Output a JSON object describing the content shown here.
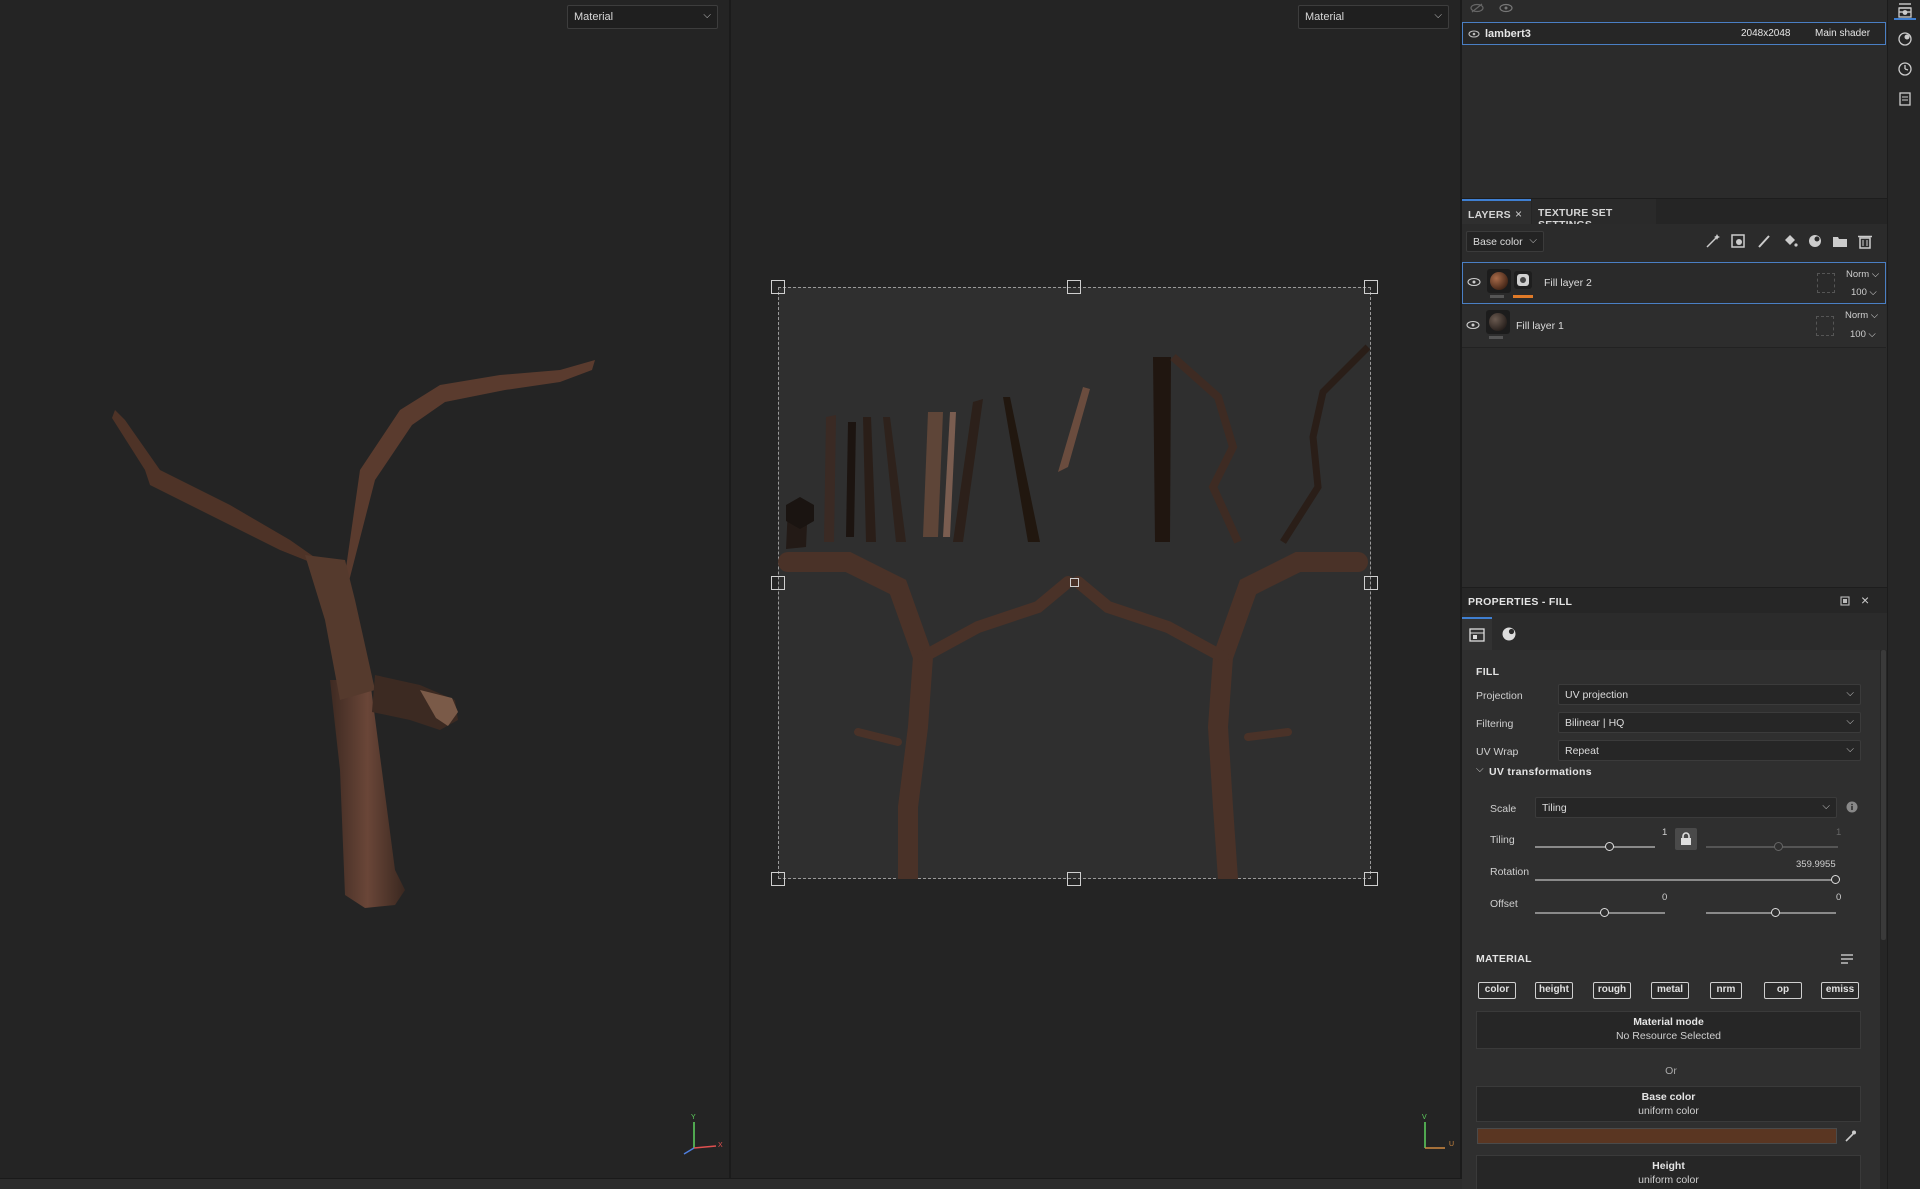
{
  "viewports": {
    "left_mode": "Material",
    "right_mode": "Material"
  },
  "texture_set": {
    "name": "lambert3",
    "resolution": "2048x2048",
    "shader": "Main shader"
  },
  "layers_panel": {
    "tab_layers": "LAYERS",
    "tab_texture_set": "TEXTURE SET SETTINGS",
    "channel_select": "Base color",
    "layers": [
      {
        "name": "Fill layer 2",
        "blend": "Norm",
        "opacity": "100",
        "selected": true
      },
      {
        "name": "Fill layer 1",
        "blend": "Norm",
        "opacity": "100",
        "selected": false
      }
    ]
  },
  "properties": {
    "title": "PROPERTIES - FILL",
    "fill_section": "FILL",
    "projection_label": "Projection",
    "projection_value": "UV projection",
    "filtering_label": "Filtering",
    "filtering_value": "Bilinear | HQ",
    "uvwrap_label": "UV Wrap",
    "uvwrap_value": "Repeat",
    "uvtrans_label": "UV transformations",
    "scale_label": "Scale",
    "scale_value": "Tiling",
    "tiling_label": "Tiling",
    "tiling_u": "1",
    "tiling_v": "1",
    "rotation_label": "Rotation",
    "rotation_value": "359.9955",
    "offset_label": "Offset",
    "offset_u": "0",
    "offset_v": "0",
    "material_section": "MATERIAL",
    "channels": [
      "color",
      "height",
      "rough",
      "metal",
      "nrm",
      "op",
      "emiss"
    ],
    "material_mode_title": "Material mode",
    "material_mode_value": "No Resource Selected",
    "or_text": "Or",
    "base_color_title": "Base color",
    "base_color_value": "uniform color",
    "base_color_hex": "#5a3622",
    "height_title": "Height",
    "height_value": "uniform color"
  },
  "axes": {
    "left_y": "Y",
    "left_x": "X",
    "left_z": "Z",
    "right_v": "V",
    "right_u": "U"
  },
  "colors": {
    "accent_blue": "#3f7fd1",
    "orange_mask": "#e07a28",
    "bark": "#5e3e30",
    "bark_light": "#8a6554"
  }
}
